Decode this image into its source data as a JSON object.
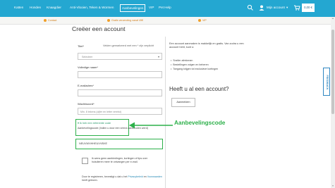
{
  "nav": {
    "items": [
      "Katten",
      "Honden",
      "Knaagdier",
      "Anti-Vlooien, Teken & Wormen",
      "Aanbevelingen",
      "VIP",
      "Pet Help"
    ],
    "active_index": 4,
    "account_label": "Mijn account",
    "cart_total": "0,00 €"
  },
  "promo": {
    "left": "Contact",
    "center": "Gratis verzending vanaf 49€",
    "right": "VIP"
  },
  "form": {
    "title": "Creëer een account",
    "title_label": "Titel*",
    "required_note": "Velden gemarkeerd met een * zijn verplicht",
    "title_select_value": "Selecteer",
    "fullname_label": "Volledige naam*",
    "email_label": "E-mailadres*",
    "password_label": "Wachtwoord*",
    "password_placeholder": "Min. 8 tekens (cijfer en letter vereist)",
    "referral_toggle": "Ik heb een referentie code",
    "referral_desc": "Aanbevelingscode (Indien u door een vriend aanbevolen werd)",
    "referral_value": "NEUVWXHHEUVVBXE",
    "consent_text": "Ik wens geen aanbiedingen, kortingen of tips over huisdieren meer te ontvangen per e-mail.",
    "privacy_text": "Door te registreren, bevestigt u dat u het",
    "privacy_link": "Privacybeleid",
    "privacy_and": "en",
    "terms_link": "Voorwaarden",
    "privacy_end": "heeft gelezen."
  },
  "right": {
    "intro": "Een account aanmaken is makkelijk en gratis. Van zodra u een account hebt, kunt u:",
    "bullets": [
      "Sneller afrekenen",
      "Bestellingen volgen en beheren",
      "Toegang krijgen tot exclusieve kortingen"
    ],
    "login_title": "Heeft u al een account?",
    "login_button": "Aanmelden"
  },
  "annotation": "Aanbevelingscode",
  "feedback_label": "FEEDBACK",
  "colors": {
    "nav_bg": "#24a7d1",
    "annotation": "#2db04a",
    "promo_text": "#d07e1c"
  }
}
